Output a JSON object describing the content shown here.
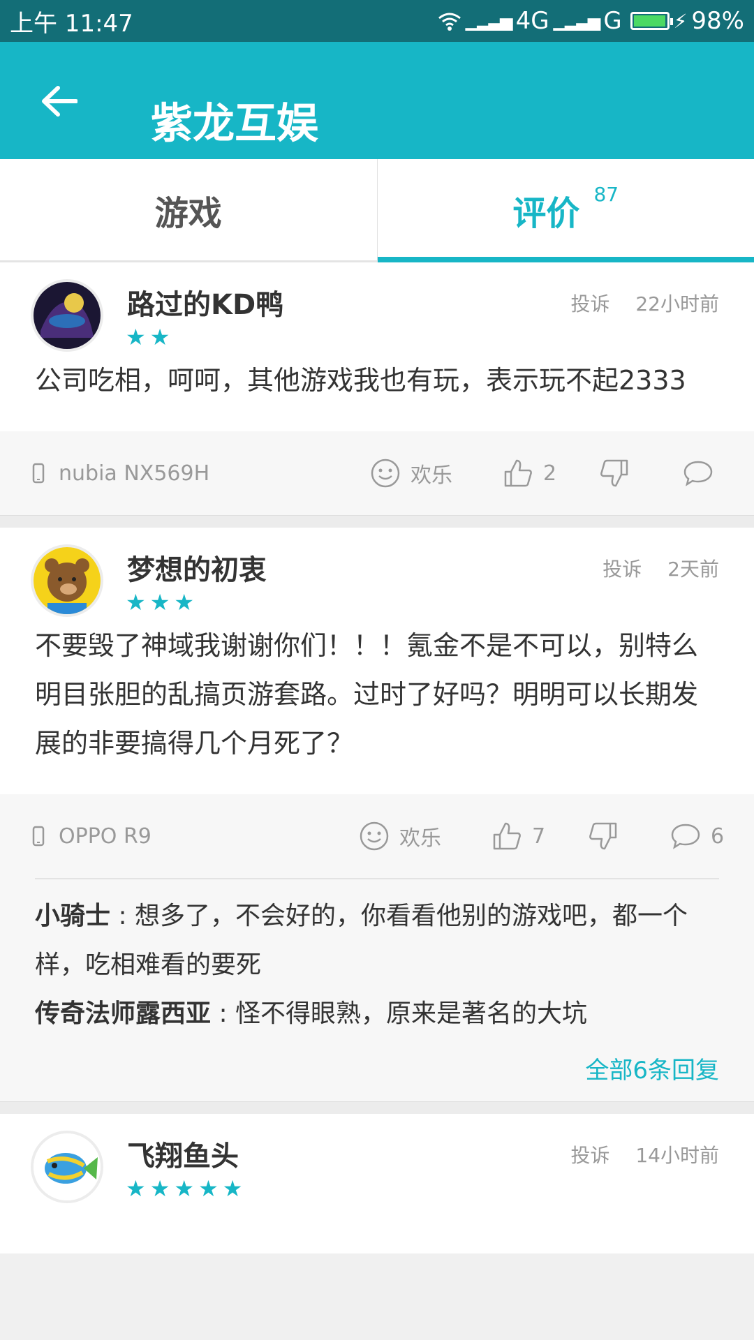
{
  "status": {
    "time": "上午 11:47",
    "network": "4G",
    "network2": "G",
    "battery": "98%",
    "battery_level": 0.98
  },
  "header": {
    "title": "紫龙互娱"
  },
  "tabs": [
    {
      "label": "游戏"
    },
    {
      "label": "评价",
      "count": "87"
    }
  ],
  "reviews": [
    {
      "username": "路过的KD鸭",
      "stars": "★★",
      "rating": 2,
      "report": "投诉",
      "time": "22小时前",
      "content": "公司吃相，呵呵，其他游戏我也有玩，表示玩不起2333",
      "device": "nubia NX569H",
      "mood": "欢乐",
      "likes": "2",
      "comments": ""
    },
    {
      "username": "梦想的初衷",
      "stars": "★★★",
      "rating": 3,
      "report": "投诉",
      "time": "2天前",
      "content": "不要毁了神域我谢谢你们！！！氪金不是不可以，别特么明目张胆的乱搞页游套路。过时了好吗？明明可以长期发展的非要搞得几个月死了？",
      "device": "OPPO R9",
      "mood": "欢乐",
      "likes": "7",
      "comments": "6",
      "replies": [
        {
          "name": "小骑士",
          "sep": " : ",
          "text": "想多了，不会好的，你看看他别的游戏吧，都一个样，吃相难看的要死"
        },
        {
          "name": "传奇法师露西亚",
          "sep": " : ",
          "text": "怪不得眼熟，原来是著名的大坑"
        }
      ],
      "all_replies": "全部6条回复"
    },
    {
      "username": "飞翔鱼头",
      "stars": "★★★★★",
      "rating": 5,
      "report": "投诉",
      "time": "14小时前"
    }
  ]
}
